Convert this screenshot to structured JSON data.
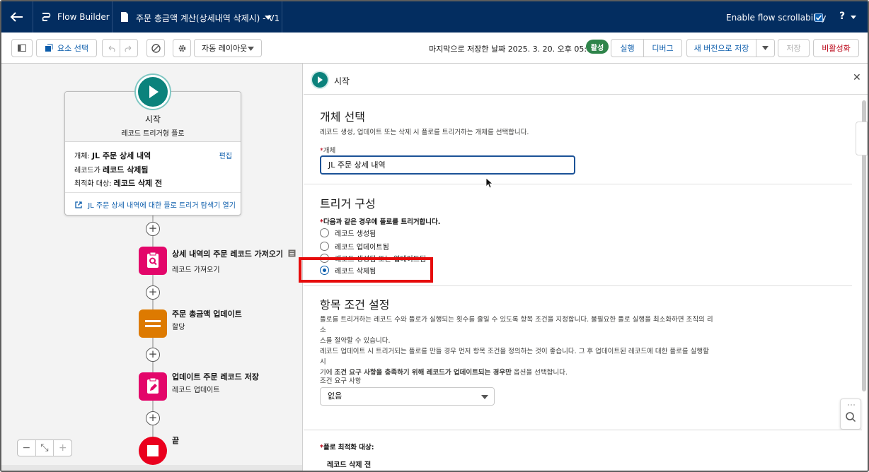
{
  "header": {
    "app_name": "Flow Builder",
    "doc_title": "주문 총금액 계산(상세내역 삭제시) - V1",
    "scrollability_label": "Enable flow scrollability",
    "help_label": "?"
  },
  "toolbar": {
    "select_elements": "요소 선택",
    "layout_select": "자동 레이아웃",
    "saved_text": "마지막으로 저장한 날짜 2025. 3. 20. 오후 05:07",
    "status_badge": "활성",
    "run": "실행",
    "debug": "디버그",
    "save_new_version": "새 버전으로 저장",
    "save": "저장",
    "deactivate": "비활성화"
  },
  "canvas": {
    "start": {
      "title": "시작",
      "subtitle": "레코드 트리거형 플로",
      "object_label": "개체:",
      "object_value": "JL 주문 상세 내역",
      "edit": "편집",
      "record_label": "레코드가",
      "record_value": "레코드 삭제됨",
      "optimize_label": "최적화 대상:",
      "optimize_value": "레코드 삭제 전",
      "explorer_link": "JL 주문 상세 내역에 대한 플로 트리거 탐색기 열기"
    },
    "nodes": [
      {
        "title": "상세 내역의 주문 레코드 가져오기",
        "type": "레코드 가져오기",
        "color": "#e3066a",
        "icon": "get-records-icon"
      },
      {
        "title": "주문 총금액 업데이트",
        "type": "할당",
        "color": "#dd7a01",
        "icon": "assignment-icon"
      },
      {
        "title": "업데이트 주문 레코드 저장",
        "type": "레코드 업데이트",
        "color": "#e3066a",
        "icon": "update-records-icon"
      }
    ],
    "end_label": "끝",
    "zoom": {
      "out": "−",
      "fit": "⤡",
      "in": "+"
    }
  },
  "panel": {
    "title": "시작",
    "object_section": {
      "heading": "개체 선택",
      "description": "레코드 생성, 업데이트 또는 삭제 시 플로를 트리거하는 개체를 선택합니다.",
      "field_label": "개체",
      "field_value": "JL 주문 상세 내역"
    },
    "trigger_section": {
      "heading": "트리거 구성",
      "question": "다음과 같은 경우에 플로를 트리거합니다.",
      "options": [
        "레코드 생성됨",
        "레코드 업데이트됨",
        "레코드 생성됨 또는 업데이트됨",
        "레코드 삭제됨"
      ],
      "selected": "레코드 삭제됨"
    },
    "entry_section": {
      "heading": "항목 조건 설정",
      "desc1a": "플로를 트리거하는 레코드 수와 플로가 실행되는 횟수를 줄일 수 있도록 항목 조건을 지정합니다. 불필요한 플로 실행을 최소화하면 조직의 리소",
      "desc1b": "스를 절약할 수 있습니다.",
      "desc2a": "레코드 업데이트 시 트리거되는 플로를 만들 경우 먼저 항목 조건을 정의하는 것이 좋습니다. 그 후 업데이트된 레코드에 대한 플로를 실행할 시",
      "desc2b_pre": "기에 ",
      "desc2b_bold": "조건 요구 사항을 충족하기 위해 레코드가 업데이트되는 경우만",
      "desc2b_post": " 옵션을 선택합니다.",
      "condition_label": "조건 요구 사항",
      "condition_value": "없음"
    },
    "optimize_section": {
      "label": "플로 최적화 대상:",
      "value": "레코드 삭제 전"
    }
  }
}
